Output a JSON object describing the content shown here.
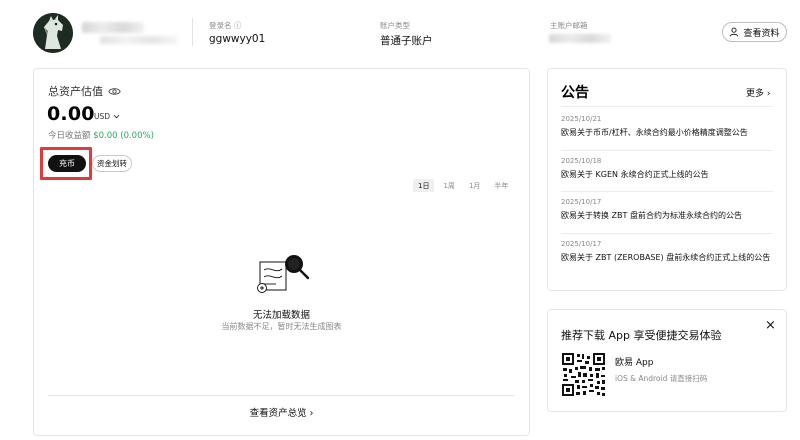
{
  "header": {
    "login_name_label": "登录名 ⓘ",
    "login_name_value": "ggwwyy01",
    "account_type_label": "账户类型",
    "account_type_value": "普通子账户",
    "main_email_label": "主账户邮箱",
    "view_profile_label": "查看资料",
    "view_profile_icon": "user-icon"
  },
  "assets": {
    "title": "总资产估值",
    "eye_icon": "eye-icon",
    "value": "0.00",
    "unit": "USD",
    "pnl_label": "今日收益额",
    "pnl_value": "$0.00 (0.00%)",
    "pnl_color": "#2aaa58",
    "deposit_label": "充币",
    "transfer_label": "资金划转",
    "highlight_color": "#e03a3a",
    "ranges": [
      "1日",
      "1周",
      "1月",
      "半年"
    ],
    "active_range": "1日",
    "empty_title": "无法加载数据",
    "empty_subtitle": "当前数据不足，暂时无法生成图表",
    "overview_link": "查看资产总览"
  },
  "announcements": {
    "title": "公告",
    "more_label": "更多",
    "items": [
      {
        "date": "2025/10/21",
        "text": "欧易关于币币/杠杆、永续合约最小价格精度调整公告"
      },
      {
        "date": "2025/10/18",
        "text": "欧易关于 KGEN 永续合约正式上线的公告"
      },
      {
        "date": "2025/10/17",
        "text": "欧易关于转换 ZBT 盘前合约为标准永续合约的公告"
      },
      {
        "date": "2025/10/17",
        "text": "欧易关于 ZBT (ZEROBASE) 盘前永续合约正式上线的公告"
      }
    ]
  },
  "app_download": {
    "title": "推荐下载 App 享受便捷交易体验",
    "close_label": "×",
    "app_name": "欧易 App",
    "app_subtitle": "iOS & Android 请直接扫码"
  }
}
